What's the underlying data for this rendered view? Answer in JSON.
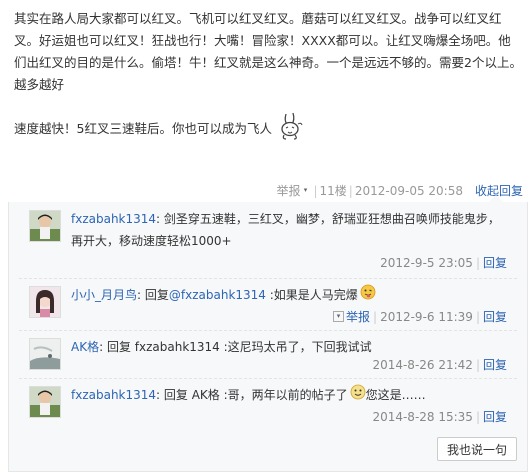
{
  "post": {
    "paragraph1": "其实在路人局大家都可以红叉。飞机可以红叉红叉。蘑菇可以红叉红叉。战争可以红叉红叉。好运姐也可以红叉！狂战也行！大嘴！冒险家！XXXX都可以。让红叉嗨爆全场吧。他们出红叉的目的是什么。偷塔！牛！红叉就是这么神奇。一个是远远不够的。需要2个以上。越多越好",
    "paragraph2": "速度越快！5红叉三速鞋后。你也可以成为飞人",
    "emoticon": "rabbit-emoticon-icon"
  },
  "post_tail": {
    "report": "举报",
    "floor": "11楼",
    "time": "2012-09-05 20:58",
    "collapse": "收起回复"
  },
  "replies": [
    {
      "username": "fxzabahk1314",
      "colon": ":",
      "text": " 剑圣穿五速鞋，三红叉，幽梦，舒瑞亚狂想曲召唤师技能鬼步，再开大，移动速度轻松1000+",
      "time": "2012-9-5 23:05",
      "reply_link": "回复"
    },
    {
      "username": "小小_月月鸟",
      "colon": ":",
      "text_prefix": " 回复",
      "mention": "@fxzabahk1314",
      "text": " :如果是人马完爆",
      "report": "举报",
      "time": "2012-9-6 11:39",
      "reply_link": "回复"
    },
    {
      "username": "AK格",
      "colon": ":",
      "text": " 回复 fxzabahk1314 :这尼玛太吊了，下回我试试",
      "time": "2014-8-26 21:42",
      "reply_link": "回复"
    },
    {
      "username": "fxzabahk1314",
      "colon": ":",
      "text": " 回复 AK格 :哥，两年以前的帖子了",
      "text_after": "您这是……",
      "time": "2014-8-28 15:35",
      "reply_link": "回复"
    }
  ],
  "say_button": "我也说一句",
  "colors": {
    "link": "#2d64b3",
    "meta": "#888888",
    "panel_bg": "#f7f8fa"
  }
}
